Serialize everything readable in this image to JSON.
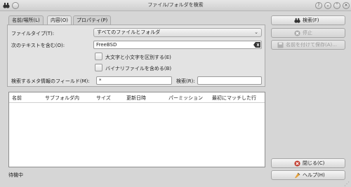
{
  "window": {
    "title": "ファイル/フォルダを検索",
    "help_btn": "?",
    "minimize_btn": "⌄",
    "maximize_btn": "⌃",
    "close_btn": "✕"
  },
  "tabs": [
    {
      "label": "名前/場所(L)"
    },
    {
      "label": "内容(O)"
    },
    {
      "label": "プロパティ(P)"
    }
  ],
  "content_tab": {
    "filetype_label": "ファイルタイプ(T):",
    "filetype_value": "すべてのファイルとフォルダ",
    "text_label": "次のテキストを含む(O):",
    "text_value": "FreeBSD",
    "case_label": "大文字と小文字を区別する(E)",
    "binary_label": "バイナリファイルを含める(B)",
    "meta_label": "検索するメタ情報のフィールド(M):",
    "meta_value": "*",
    "search_label": "検索(R):",
    "search_value": ""
  },
  "results": {
    "columns": [
      "名前",
      "サブフォルダ内",
      "サイズ",
      "更新日時",
      "パーミッション",
      "最初にマッチした行"
    ]
  },
  "buttons": {
    "search": "検索(F)",
    "stop": "停止",
    "save_as": "名前を付けて保存(A)...",
    "close": "閉じる(C)",
    "help": "ヘルプ(H)"
  },
  "status": "待機中"
}
